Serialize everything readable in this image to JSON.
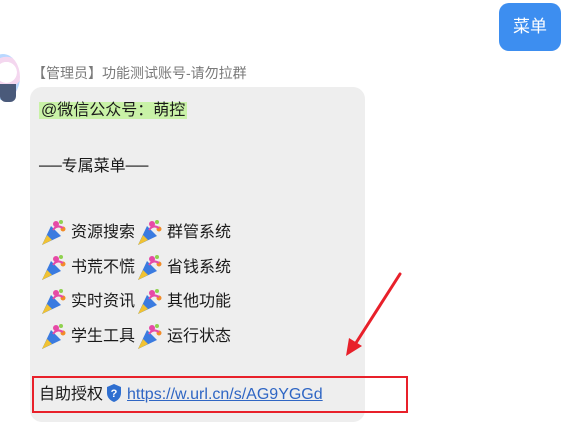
{
  "outgoing": {
    "text": "菜单"
  },
  "incoming": {
    "sender": "【管理员】功能测试账号-请勿拉群",
    "mention": "@微信公众号：萌控",
    "menu_title": "──专属菜单──",
    "menu_items": [
      [
        "资源搜索",
        "群管系统"
      ],
      [
        "书荒不慌",
        "省钱系统"
      ],
      [
        "实时资讯",
        "其他功能"
      ],
      [
        "学生工具",
        "运行状态"
      ]
    ],
    "auth_label": "自助授权",
    "auth_url": "https://w.url.cn/s/AG9YGGd"
  },
  "colors": {
    "outgoing_bubble": "#3d8ef0",
    "incoming_bubble": "#eeeeee",
    "mention_highlight": "#c9f2a7",
    "link": "#2f66c4",
    "annotation_red": "#e8202a"
  },
  "icons": {
    "menu_item_icon": "party-popper-icon",
    "auth_icon": "shield-question-icon",
    "annotation": "red-arrow-icon"
  }
}
